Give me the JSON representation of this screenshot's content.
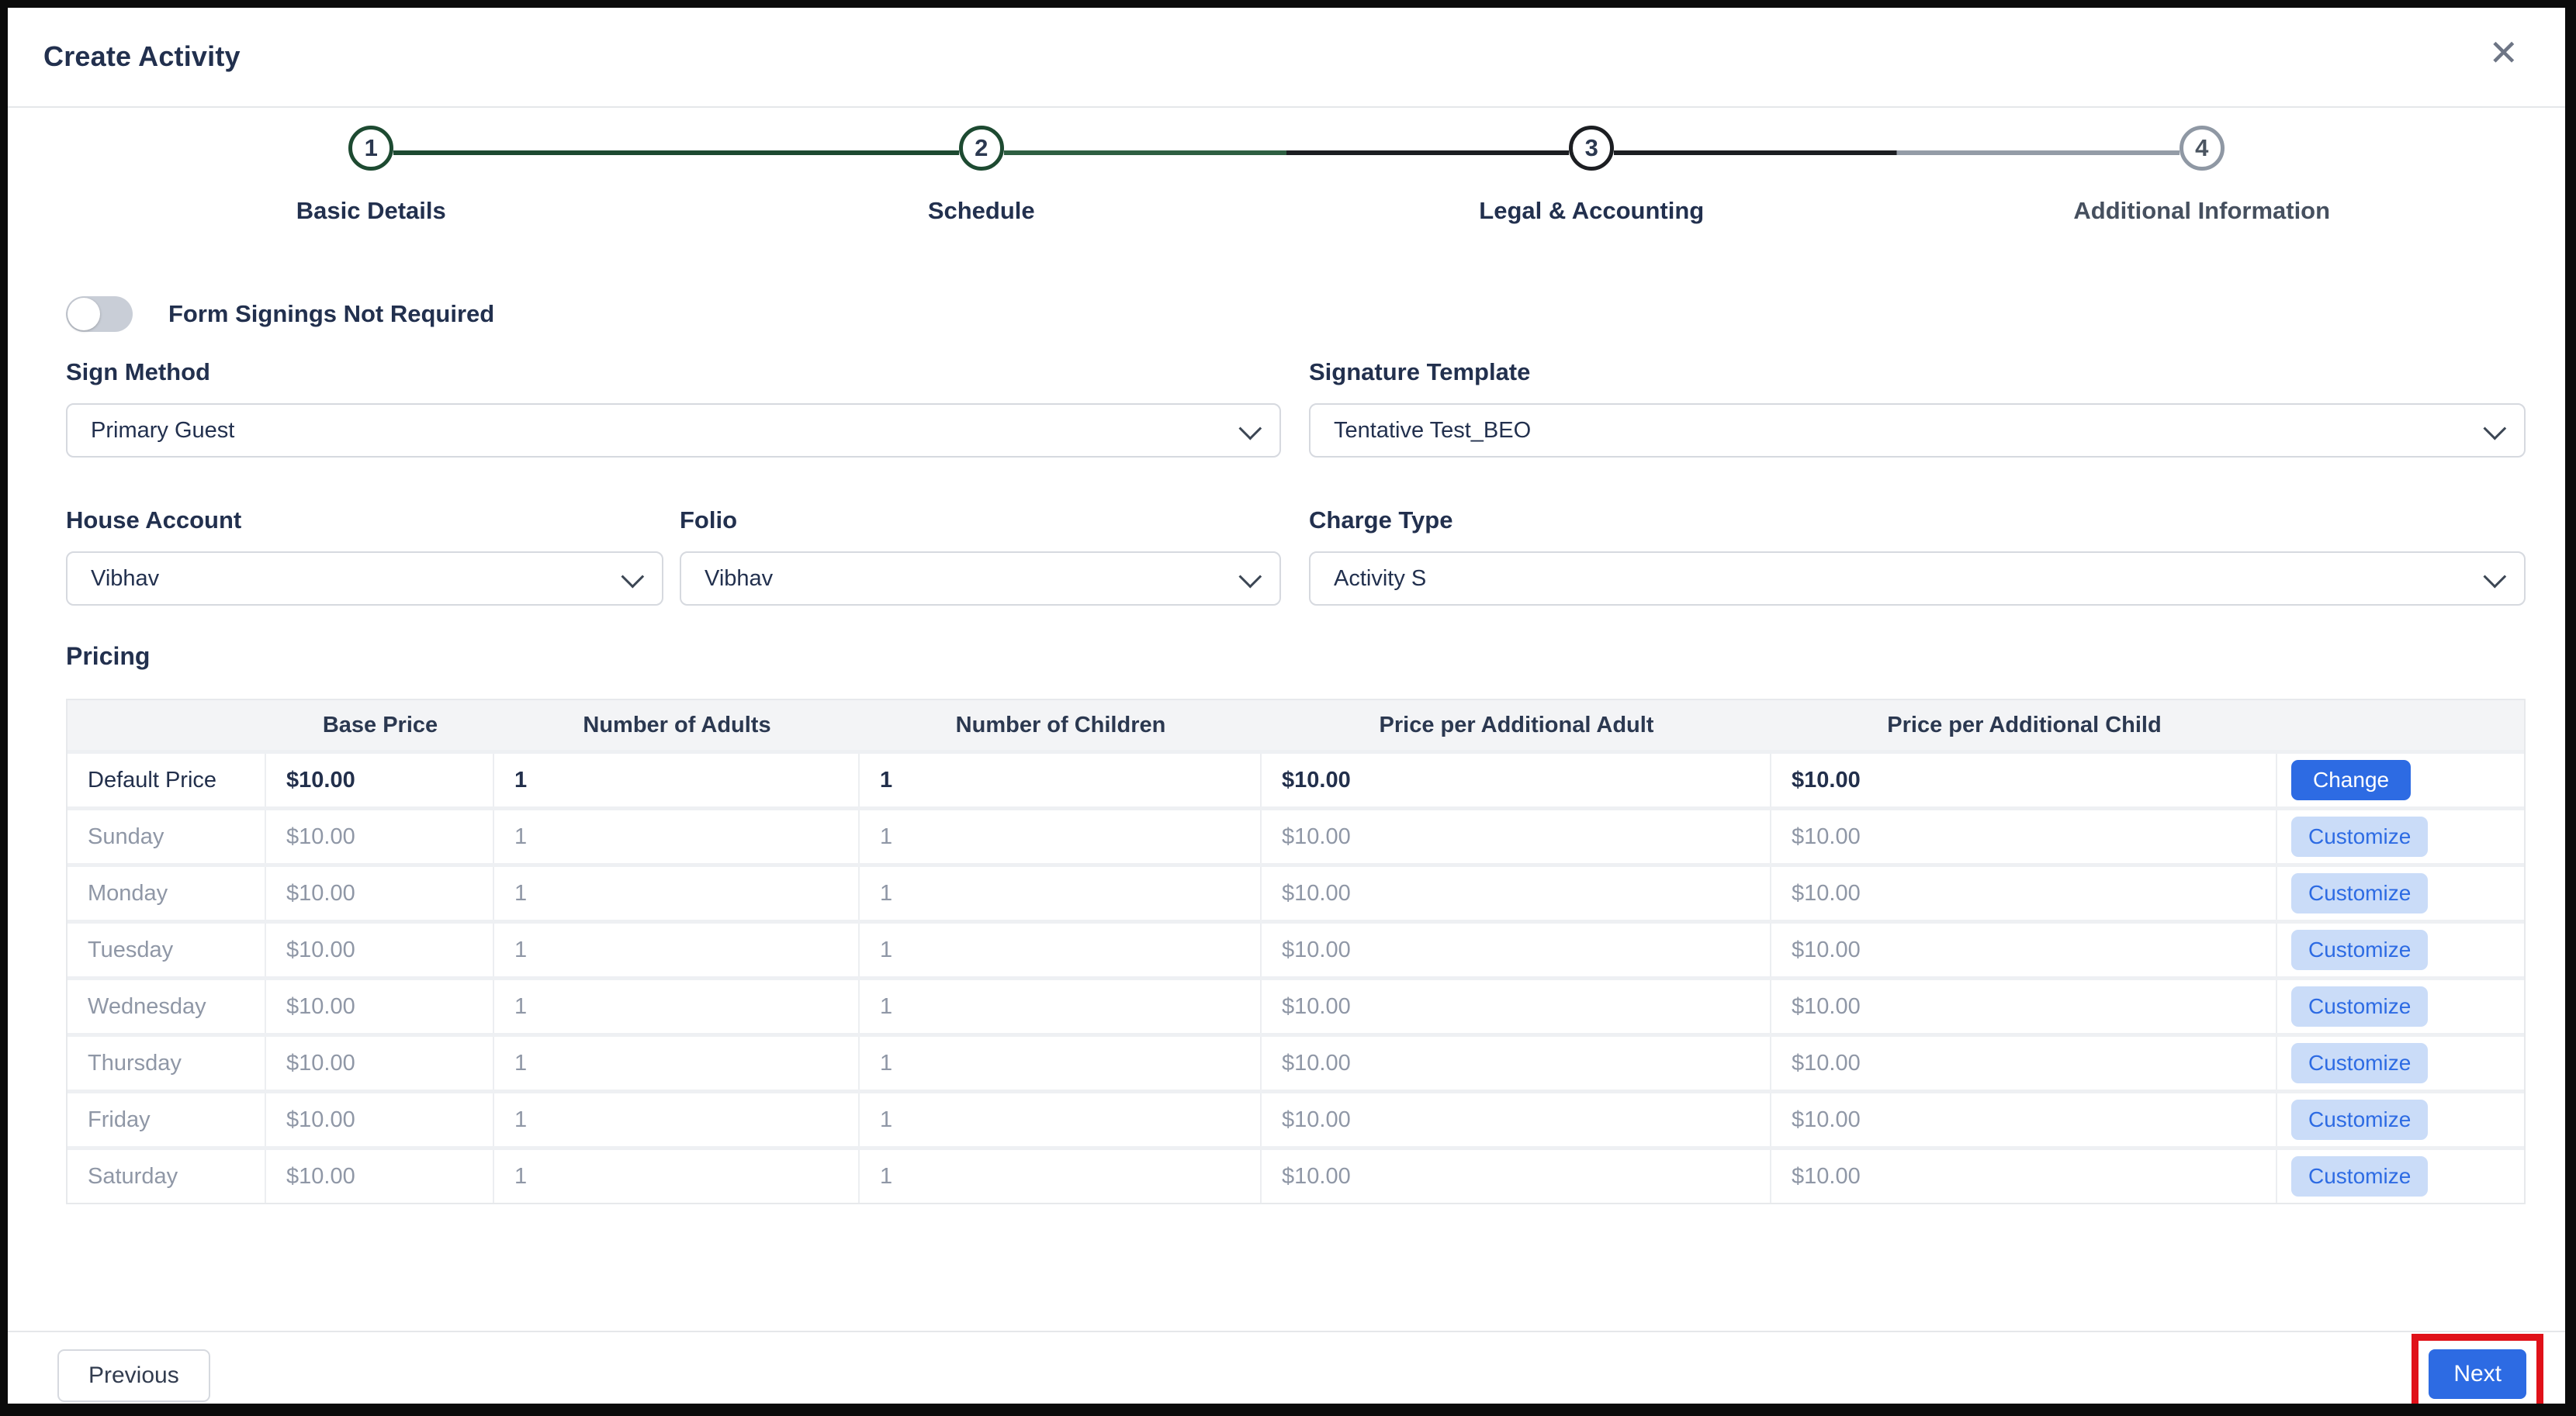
{
  "modal": {
    "title": "Create Activity",
    "close_icon": "✕"
  },
  "stepper": {
    "steps": [
      {
        "number": "1",
        "label": "Basic Details",
        "state": "completed"
      },
      {
        "number": "2",
        "label": "Schedule",
        "state": "completed"
      },
      {
        "number": "3",
        "label": "Legal & Accounting",
        "state": "active"
      },
      {
        "number": "4",
        "label": "Additional Information",
        "state": "upcoming"
      }
    ]
  },
  "form": {
    "toggle": {
      "label": "Form Signings Not Required",
      "state": "off"
    },
    "sign_method": {
      "label": "Sign Method",
      "value": "Primary Guest"
    },
    "signature_template": {
      "label": "Signature Template",
      "value": "Tentative Test_BEO"
    },
    "house_account": {
      "label": "House Account",
      "value": "Vibhav"
    },
    "folio": {
      "label": "Folio",
      "value": "Vibhav"
    },
    "charge_type": {
      "label": "Charge Type",
      "value": "Activity S"
    }
  },
  "pricing": {
    "section_title": "Pricing",
    "columns": [
      "",
      "Base Price",
      "Number of Adults",
      "Number of Children",
      "Price per Additional Adult",
      "Price per Additional Child",
      ""
    ],
    "rows": [
      {
        "type": "default",
        "label": "Default Price",
        "values": [
          "$10.00",
          "1",
          "1",
          "$10.00",
          "$10.00"
        ],
        "action": "Change"
      },
      {
        "type": "day",
        "label": "Sunday",
        "values": [
          "$10.00",
          "1",
          "1",
          "$10.00",
          "$10.00"
        ],
        "action": "Customize"
      },
      {
        "type": "day",
        "label": "Monday",
        "values": [
          "$10.00",
          "1",
          "1",
          "$10.00",
          "$10.00"
        ],
        "action": "Customize"
      },
      {
        "type": "day",
        "label": "Tuesday",
        "values": [
          "$10.00",
          "1",
          "1",
          "$10.00",
          "$10.00"
        ],
        "action": "Customize"
      },
      {
        "type": "day",
        "label": "Wednesday",
        "values": [
          "$10.00",
          "1",
          "1",
          "$10.00",
          "$10.00"
        ],
        "action": "Customize"
      },
      {
        "type": "day",
        "label": "Thursday",
        "values": [
          "$10.00",
          "1",
          "1",
          "$10.00",
          "$10.00"
        ],
        "action": "Customize"
      },
      {
        "type": "day",
        "label": "Friday",
        "values": [
          "$10.00",
          "1",
          "1",
          "$10.00",
          "$10.00"
        ],
        "action": "Customize"
      },
      {
        "type": "day",
        "label": "Saturday",
        "values": [
          "$10.00",
          "1",
          "1",
          "$10.00",
          "$10.00"
        ],
        "action": "Customize"
      }
    ]
  },
  "footer": {
    "previous_label": "Previous",
    "next_label": "Next"
  },
  "colors": {
    "accent_blue": "#2d6be3",
    "customize_bg": "#cadcf8",
    "step_green": "#1d4a31",
    "step_black": "#1c1e22",
    "step_gray": "#949ca7",
    "annotation_red": "#e01119",
    "dark_text": "#22304e",
    "muted_text": "#8f97a6",
    "table_header_bg": "#f3f4f6"
  }
}
